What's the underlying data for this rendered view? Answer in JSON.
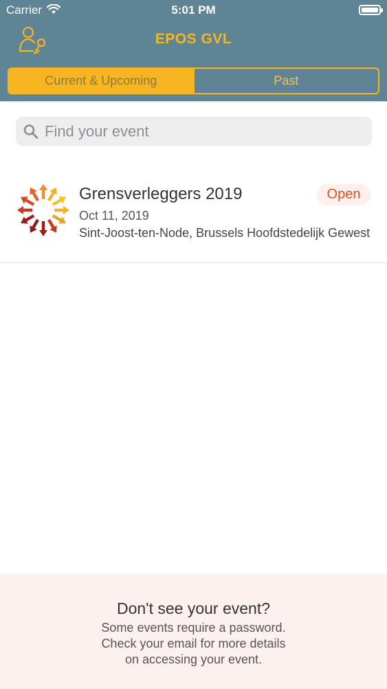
{
  "status_bar": {
    "carrier": "Carrier",
    "time": "5:01 PM"
  },
  "header": {
    "title": "EPOS GVL",
    "account_icon": "user-key-icon",
    "tabs": [
      {
        "label": "Current & Upcoming",
        "active": true
      },
      {
        "label": "Past",
        "active": false
      }
    ]
  },
  "search": {
    "placeholder": "Find your event",
    "value": ""
  },
  "events": [
    {
      "title": "Grensverleggers 2019",
      "date": "Oct 11, 2019",
      "location": "Sint-Joost-ten-Node, Brussels Hoofdstedelijk Gewest",
      "status": "Open"
    }
  ],
  "footer": {
    "title": "Don't see your event?",
    "lines": [
      "Some events require a password.",
      "Check your email for more details",
      "on accessing your event."
    ]
  },
  "colors": {
    "header_bg": "#5e8496",
    "accent": "#f7b521",
    "status_open": "#d9531e",
    "footer_bg": "#fdf1ef"
  }
}
